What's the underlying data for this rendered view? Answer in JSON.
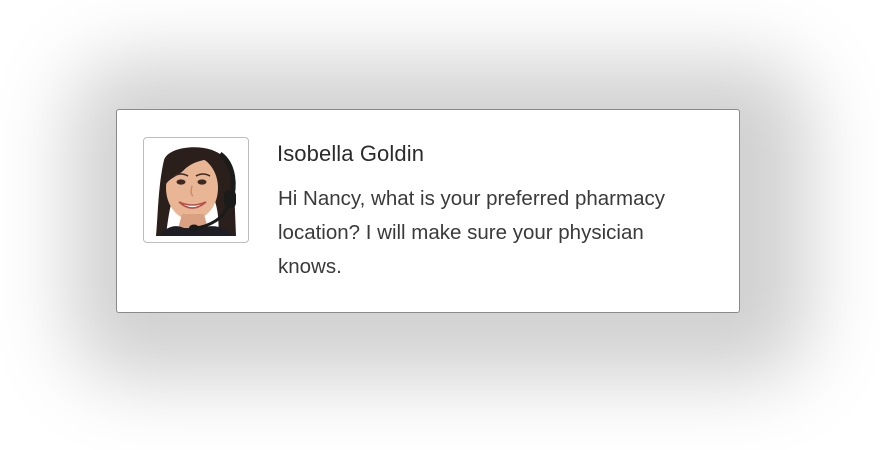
{
  "notification": {
    "sender_name": "Isobella Goldin",
    "message": "Hi Nancy, what is your preferred pharmacy location? I will make sure your physician knows.",
    "avatar_icon": "agent-headset-avatar",
    "border_color": "#8a8a8a",
    "text_color": "#2b2b2b"
  }
}
